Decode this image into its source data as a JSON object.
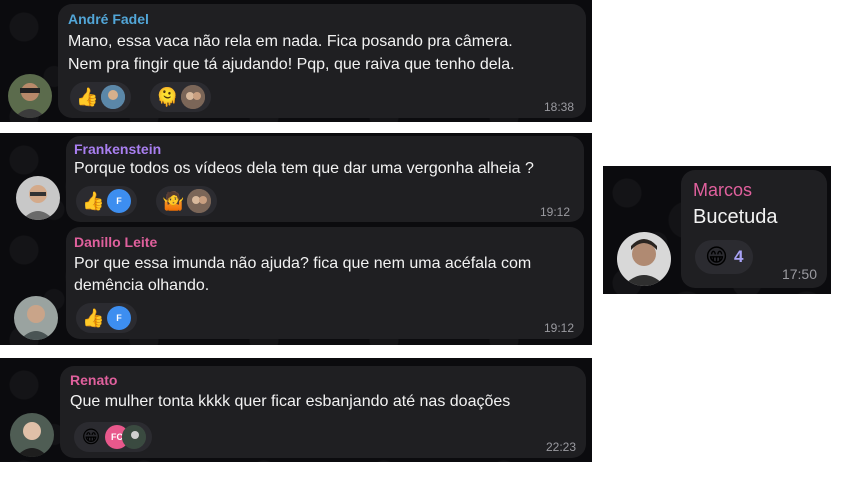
{
  "messages": [
    {
      "sender": "André Fadel",
      "sender_color": "#52a6d8",
      "lines": [
        "Mano, essa vaca não rela em nada. Fica posando pra câmera.",
        "Nem pra fingir que tá ajudando! Pqp, que raiva que tenho dela."
      ],
      "time": "18:38",
      "reactions": [
        {
          "emoji": "👍"
        },
        {
          "emoji": "🫠"
        }
      ]
    },
    {
      "sender": "Frankenstein",
      "sender_color": "#a97ff0",
      "lines": [
        "Porque todos os vídeos dela tem que dar uma vergonha alheia ?"
      ],
      "time": "19:12",
      "reactions": [
        {
          "emoji": "👍",
          "avatar_initial": "F"
        },
        {
          "emoji": "🤷"
        }
      ]
    },
    {
      "sender": "Danillo Leite",
      "sender_color": "#e0609d",
      "lines": [
        "Por que essa imunda não ajuda? fica que nem uma acéfala com",
        "demência olhando."
      ],
      "time": "19:12",
      "reactions": [
        {
          "emoji": "👍",
          "avatar_initial": "F"
        }
      ]
    },
    {
      "sender": "Renato",
      "sender_color": "#e0609d",
      "lines": [
        "Que mulher tonta kkkk quer ficar esbanjando até nas doações"
      ],
      "time": "22:23",
      "reactions": [
        {
          "emoji": "😁",
          "avatar_initial": "FC"
        }
      ]
    },
    {
      "sender": "Marcos",
      "sender_color": "#e0609d",
      "lines": [
        "Bucetuda"
      ],
      "time": "17:50",
      "reactions": [
        {
          "emoji": "😁",
          "count": "4"
        }
      ]
    }
  ],
  "colors": {
    "background": "#0b0b0e",
    "bubble": "#1f1f22",
    "reaction_pill": "#2b2b30",
    "time": "#9a9aa0",
    "count": "#a9a3f7",
    "mini_avatar_blue": "#3d8ef0",
    "mini_avatar_pink": "#e8588c"
  }
}
